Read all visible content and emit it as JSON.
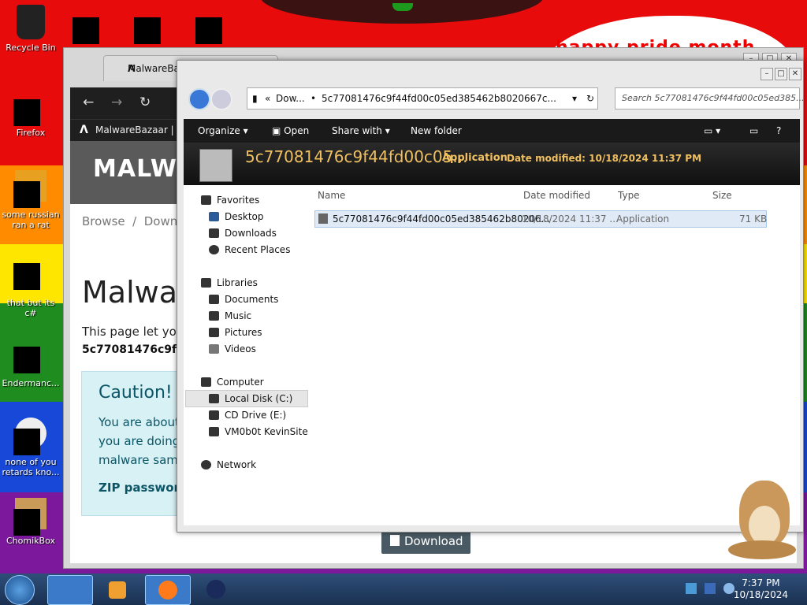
{
  "desktop": {
    "banner": "happy pride month",
    "icons": [
      {
        "label": "Recycle Bin",
        "icon": "recycle-bin-icon"
      },
      {
        "label": "Firefox",
        "icon": "firefox-icon"
      },
      {
        "label": "some russian ran a rat",
        "icon": "app-icon"
      },
      {
        "label": "that but its c#",
        "icon": "app-icon"
      },
      {
        "label": "Endermanc...",
        "icon": "app-icon"
      },
      {
        "label": "none of you retards kno...",
        "icon": "app-icon"
      },
      {
        "label": "ChomikBox",
        "icon": "hamster-icon"
      }
    ]
  },
  "browser": {
    "tab_title": "MalwareBazaar | Ma",
    "bookmark": "MalwareBazaar | Ma",
    "site_title": "MALWA",
    "breadcrumb": "Browse  /  Downlo",
    "page_title": "Malwar",
    "intro": "This page let you",
    "hash": "5c77081476c9f4",
    "caution_title": "Caution!",
    "caution_body": "You are about\nyou are doing\nmalware samp",
    "zip_label": "ZIP password",
    "download_label": "Download"
  },
  "explorer": {
    "address_prefix": "«",
    "address_parts": [
      "Dow...",
      "5c77081476c9f44fd00c05ed385462b8020667c..."
    ],
    "search_placeholder": "Search 5c77081476c9f44fd00c05ed385...",
    "toolbar": {
      "organize": "Organize",
      "open": "Open",
      "share_with": "Share with",
      "new_folder": "New folder"
    },
    "details": {
      "name": "5c77081476c9f44fd00c05...",
      "type": "Application",
      "date_label": "Date modified:",
      "date_value": "10/18/2024 11:37 PM"
    },
    "nav": {
      "favorites": "Favorites",
      "desktop": "Desktop",
      "downloads": "Downloads",
      "recent": "Recent Places",
      "libraries": "Libraries",
      "documents": "Documents",
      "music": "Music",
      "pictures": "Pictures",
      "videos": "Videos",
      "computer": "Computer",
      "local_disk": "Local Disk (C:)",
      "cd_drive": "CD Drive (E:)",
      "vm_share": "VM0b0t KevinSite",
      "network": "Network"
    },
    "columns": {
      "name": "Name",
      "date": "Date modified",
      "type": "Type",
      "size": "Size"
    },
    "files": [
      {
        "name": "5c77081476c9f44fd00c05ed385462b80206...",
        "date": "10/18/2024 11:37 ...",
        "type": "Application",
        "size": "71 KB"
      }
    ]
  },
  "taskbar": {
    "time": "7:37 PM",
    "date": "10/18/2024"
  },
  "colors": {
    "accent": "#f0c060",
    "taskbar": "#1a3050"
  }
}
